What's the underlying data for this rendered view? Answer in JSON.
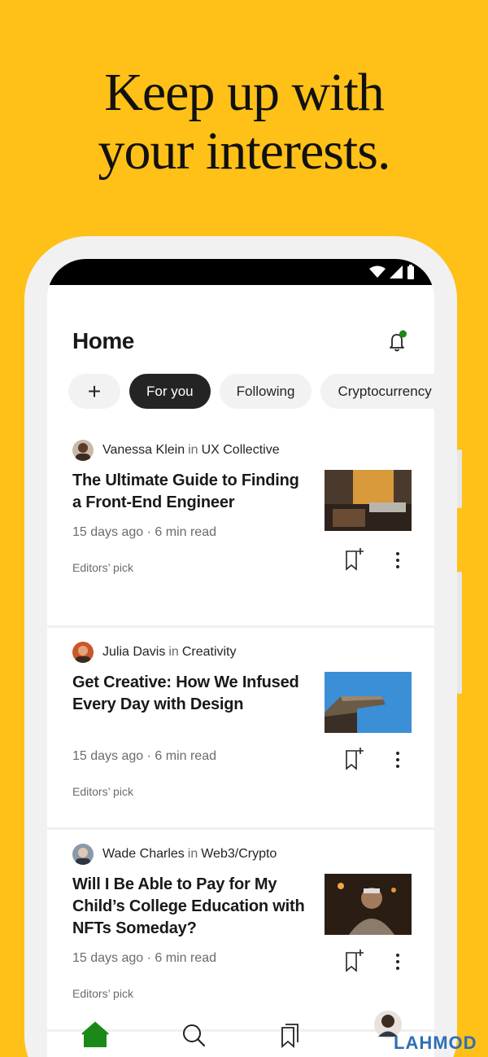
{
  "headline": {
    "line1": "Keep up with",
    "line2": "your interests."
  },
  "status_bar": {
    "icons": [
      "wifi-icon",
      "signal-icon",
      "battery-icon"
    ]
  },
  "header": {
    "title": "Home",
    "notification_icon": "bell-icon",
    "notification_dot_color": "#1A8917"
  },
  "chips": {
    "add_icon": "+",
    "items": [
      "For you",
      "Following",
      "Cryptocurrency"
    ],
    "active": "For you"
  },
  "articles": [
    {
      "author": "Vanessa Klein",
      "in_word": "in",
      "publication": "UX Collective",
      "title": "The Ultimate Guide to Finding a Front-End Engineer",
      "meta": "15 days ago · 6 min read",
      "label": "Editors’ pick"
    },
    {
      "author": "Julia Davis",
      "in_word": "in",
      "publication": "Creativity",
      "title": "Get Creative: How We Infused Every Day with Design",
      "meta": "15 days ago · 6 min read",
      "label": "Editors’ pick"
    },
    {
      "author": "Wade Charles",
      "in_word": "in",
      "publication": "Web3/Crypto",
      "title": "Will I Be Able to Pay for My Child’s College Education with NFTs Someday?",
      "meta": "15 days ago · 6 min read",
      "label": "Editors’ pick"
    }
  ],
  "bottom_nav": {
    "items": [
      "home-icon",
      "search-icon",
      "bookmarks-icon",
      "profile-avatar"
    ],
    "active": "home-icon",
    "active_color": "#1A8917"
  },
  "watermark": "LAHMOD",
  "colors": {
    "background": "#FFC017",
    "text": "#242424",
    "muted": "#6B6B6B"
  }
}
